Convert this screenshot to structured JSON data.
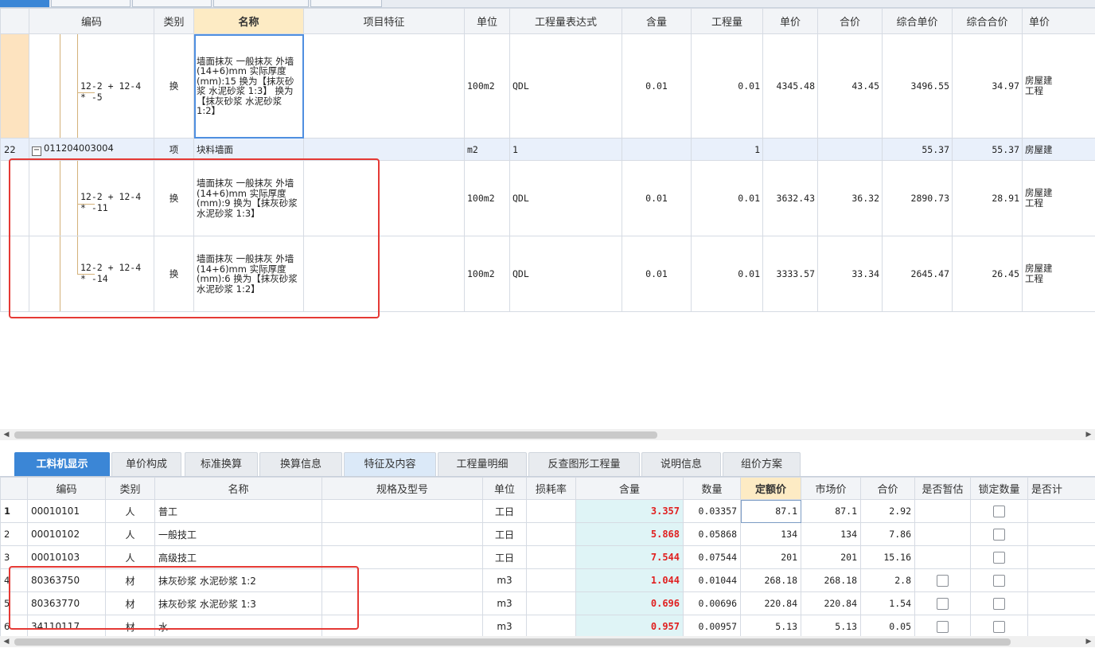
{
  "colors": {
    "accent_tab": "#3b86d6",
    "header_highlight": "#fdebc4",
    "qty_red": "#e02020",
    "annotation_red": "#e53935",
    "qty_bg": "#dff4f6"
  },
  "upper_grid": {
    "headers": [
      "",
      "编码",
      "类别",
      "名称",
      "项目特征",
      "单位",
      "工程量表达式",
      "含量",
      "工程量",
      "单价",
      "合价",
      "综合单价",
      "综合合价",
      "单价"
    ],
    "rows": [
      {
        "idx": "",
        "code": "12-2 + 12-4\n* -5",
        "type": "换",
        "name": "墙面抹灰 一般抹灰 外墙 (14+6)mm 实际厚度(mm):15 换为【抹灰砂浆 水泥砂浆 1:3】 换为【抹灰砂浆 水泥砂浆 1:2】",
        "feature": "",
        "unit": "100m2",
        "expr": "QDL",
        "content": "0.01",
        "qty": "0.01",
        "price": "4345.48",
        "total": "43.45",
        "comp_price": "3496.55",
        "comp_total": "34.97",
        "extra": "房屋建\n工程"
      },
      {
        "idx": "22",
        "code": "011204003004",
        "type": "项",
        "name": "块料墙面",
        "feature": "",
        "unit": "m2",
        "expr": "1",
        "content": "",
        "qty": "1",
        "price": "",
        "total": "",
        "comp_price": "55.37",
        "comp_total": "55.37",
        "extra": "房屋建"
      },
      {
        "idx": "",
        "code": "12-2 + 12-4\n* -11",
        "type": "换",
        "name": "墙面抹灰 一般抹灰 外墙 (14+6)mm 实际厚度(mm):9 换为【抹灰砂浆 水泥砂浆 1:3】",
        "feature": "",
        "unit": "100m2",
        "expr": "QDL",
        "content": "0.01",
        "qty": "0.01",
        "price": "3632.43",
        "total": "36.32",
        "comp_price": "2890.73",
        "comp_total": "28.91",
        "extra": "房屋建\n工程"
      },
      {
        "idx": "",
        "code": "12-2 + 12-4\n* -14",
        "type": "换",
        "name": "墙面抹灰 一般抹灰 外墙 (14+6)mm 实际厚度(mm):6 换为【抹灰砂浆 水泥砂浆 1:2】",
        "feature": "",
        "unit": "100m2",
        "expr": "QDL",
        "content": "0.01",
        "qty": "0.01",
        "price": "3333.57",
        "total": "33.34",
        "comp_price": "2645.47",
        "comp_total": "26.45",
        "extra": "房屋建\n工程"
      }
    ]
  },
  "lower_tabs": [
    "工料机显示",
    "单价构成",
    "标准换算",
    "换算信息",
    "特征及内容",
    "工程量明细",
    "反查图形工程量",
    "说明信息",
    "组价方案"
  ],
  "lower_grid": {
    "headers": [
      "",
      "编码",
      "类别",
      "名称",
      "规格及型号",
      "单位",
      "损耗率",
      "含量",
      "数量",
      "定额价",
      "市场价",
      "合价",
      "是否暂估",
      "锁定数量",
      "是否计"
    ],
    "rows": [
      {
        "no": "1",
        "code": "00010101",
        "type": "人",
        "name": "普工",
        "spec": "",
        "unit": "工日",
        "loss": "",
        "content": "3.357",
        "amount": "0.03357",
        "quota": "87.1",
        "market": "87.1",
        "total": "2.92",
        "est": false,
        "lock": true
      },
      {
        "no": "2",
        "code": "00010102",
        "type": "人",
        "name": "一般技工",
        "spec": "",
        "unit": "工日",
        "loss": "",
        "content": "5.868",
        "amount": "0.05868",
        "quota": "134",
        "market": "134",
        "total": "7.86",
        "est": false,
        "lock": true
      },
      {
        "no": "3",
        "code": "00010103",
        "type": "人",
        "name": "高级技工",
        "spec": "",
        "unit": "工日",
        "loss": "",
        "content": "7.544",
        "amount": "0.07544",
        "quota": "201",
        "market": "201",
        "total": "15.16",
        "est": false,
        "lock": true
      },
      {
        "no": "4",
        "code": "80363750",
        "type": "材",
        "name": "抹灰砂浆 水泥砂浆 1:2",
        "spec": "",
        "unit": "m3",
        "loss": "",
        "content": "1.044",
        "amount": "0.01044",
        "quota": "268.18",
        "market": "268.18",
        "total": "2.8",
        "est": true,
        "lock": true
      },
      {
        "no": "5",
        "code": "80363770",
        "type": "材",
        "name": "抹灰砂浆 水泥砂浆 1:3",
        "spec": "",
        "unit": "m3",
        "loss": "",
        "content": "0.696",
        "amount": "0.00696",
        "quota": "220.84",
        "market": "220.84",
        "total": "1.54",
        "est": true,
        "lock": true
      },
      {
        "no": "6",
        "code": "34110117",
        "type": "材",
        "name": "水",
        "spec": "",
        "unit": "m3",
        "loss": "",
        "content": "0.957",
        "amount": "0.00957",
        "quota": "5.13",
        "market": "5.13",
        "total": "0.05",
        "est": true,
        "lock": true
      }
    ]
  }
}
